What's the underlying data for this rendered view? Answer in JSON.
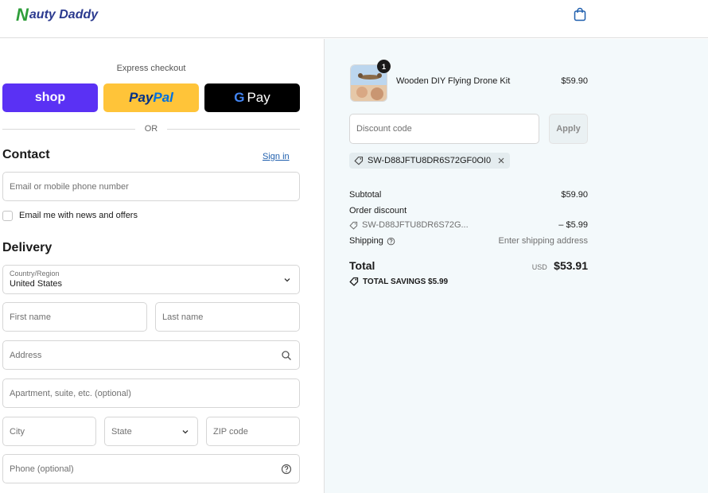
{
  "header": {
    "brand_n": "N",
    "brand_rest": "auty Daddy",
    "cart_icon": "shopping-bag-icon"
  },
  "express": {
    "label": "Express checkout",
    "shop_label": "shop",
    "paypal_pay": "Pay",
    "paypal_pal": "Pal",
    "gpay_g": "G",
    "gpay_label": "Pay",
    "or_label": "OR"
  },
  "contact": {
    "title": "Contact",
    "signin_label": "Sign in",
    "email_placeholder": "Email or mobile phone number",
    "newsletter_label": "Email me with news and offers"
  },
  "delivery": {
    "title": "Delivery",
    "country_caption": "Country/Region",
    "country_value": "United States",
    "first_name_placeholder": "First name",
    "last_name_placeholder": "Last name",
    "address_placeholder": "Address",
    "apartment_placeholder": "Apartment, suite, etc. (optional)",
    "city_placeholder": "City",
    "state_placeholder": "State",
    "zip_placeholder": "ZIP code",
    "phone_placeholder": "Phone (optional)"
  },
  "order": {
    "item": {
      "quantity": "1",
      "name": "Wooden DIY Flying Drone Kit",
      "price": "$59.90"
    },
    "discount_placeholder": "Discount code",
    "apply_label": "Apply",
    "applied_code": "SW-D88JFTU8DR6S72GF0OI0",
    "subtotal_label": "Subtotal",
    "subtotal_value": "$59.90",
    "order_discount_label": "Order discount",
    "discount_code_short": "SW-D88JFTU8DR6S72G...",
    "discount_value": "– $5.99",
    "shipping_label": "Shipping",
    "shipping_value": "Enter shipping address",
    "total_label": "Total",
    "currency": "USD",
    "total_value": "$53.91",
    "savings_label": "TOTAL SAVINGS $5.99"
  },
  "colors": {
    "shop": "#5a31f4",
    "paypal": "#ffc439",
    "gpay": "#000000",
    "link": "#1f5fae",
    "summary_bg": "#f3f9fb"
  }
}
